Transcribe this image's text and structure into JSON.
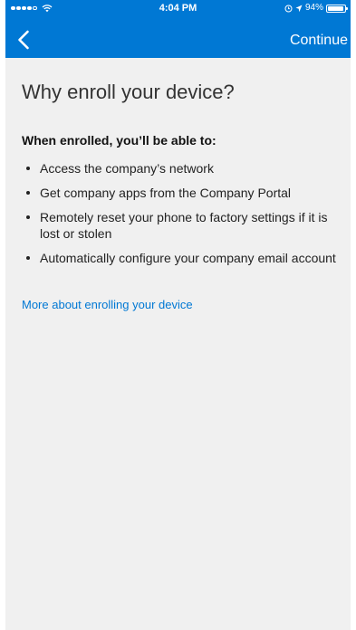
{
  "status_bar": {
    "time": "4:04 PM",
    "battery_text": "94%",
    "battery_level": 0.94,
    "signal_bars_filled": 4,
    "signal_bars_total": 5,
    "icons": [
      "wifi-icon",
      "alarm-icon",
      "location-arrow-icon",
      "battery-icon"
    ]
  },
  "nav": {
    "back_icon": "chevron-left-icon",
    "continue_label": "Continue"
  },
  "main": {
    "title": "Why enroll your device?",
    "subheading": "When enrolled, you’ll be able to:",
    "benefits": [
      "Access the company’s network",
      "Get company apps from the Company Portal",
      "Remotely reset your phone to factory settings if it is lost or stolen",
      "Automatically configure your company email account"
    ],
    "more_link": "More about enrolling your device"
  },
  "colors": {
    "header_blue": "#0078d4",
    "background": "#f0f0f0",
    "link": "#0078d4"
  }
}
